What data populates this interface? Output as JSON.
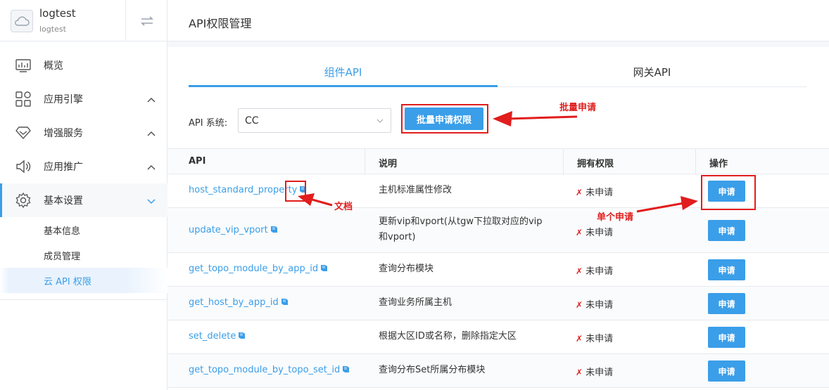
{
  "app": {
    "name": "logtest",
    "code": "logtest"
  },
  "sidebar": {
    "items": [
      {
        "label": "概览"
      },
      {
        "label": "应用引擎"
      },
      {
        "label": "增强服务"
      },
      {
        "label": "应用推广"
      },
      {
        "label": "基本设置"
      }
    ],
    "sub_items": [
      {
        "label": "基本信息"
      },
      {
        "label": "成员管理"
      },
      {
        "label": "云 API 权限"
      }
    ]
  },
  "header": {
    "title": "API权限管理"
  },
  "tabs": [
    {
      "label": "组件API"
    },
    {
      "label": "网关API"
    }
  ],
  "filter": {
    "label": "API 系统:",
    "value": "CC",
    "batch_button": "批量申请权限"
  },
  "table": {
    "headers": [
      "API",
      "说明",
      "拥有权限",
      "操作"
    ],
    "rows": [
      {
        "api": "host_standard_property",
        "desc": "主机标准属性修改",
        "perm": "未申请",
        "action": "申请"
      },
      {
        "api": "update_vip_vport",
        "desc": "更新vip和vport(从tgw下拉取对应的vip和vport)",
        "perm": "未申请",
        "action": "申请"
      },
      {
        "api": "get_topo_module_by_app_id",
        "desc": "查询分布模块",
        "perm": "未申请",
        "action": "申请"
      },
      {
        "api": "get_host_by_app_id",
        "desc": "查询业务所属主机",
        "perm": "未申请",
        "action": "申请"
      },
      {
        "api": "set_delete",
        "desc": "根据大区ID或名称，删除指定大区",
        "perm": "未申请",
        "action": "申请"
      },
      {
        "api": "get_topo_module_by_topo_set_id",
        "desc": "查询分布Set所属分布模块",
        "perm": "未申请",
        "action": "申请"
      }
    ]
  },
  "annotations": {
    "batch": "批量申请",
    "doc": "文档",
    "single": "单个申请"
  },
  "colors": {
    "accent": "#3a9ee9",
    "annotation": "#e11d1d"
  }
}
